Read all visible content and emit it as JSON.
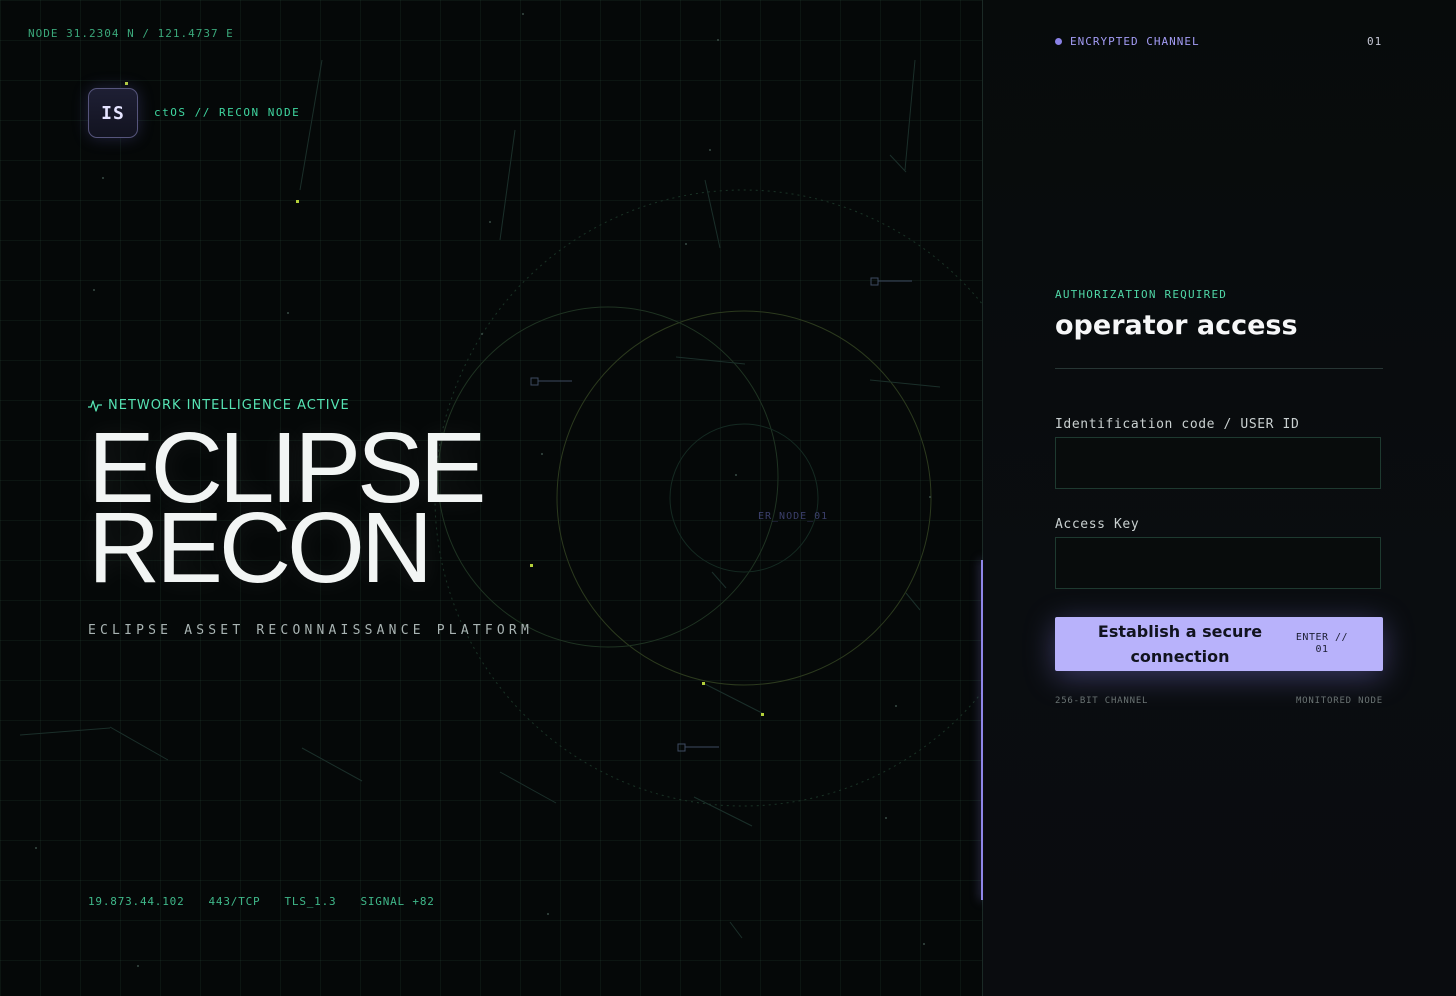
{
  "hero": {
    "coords": "NODE 31.2304 N / 121.4737 E",
    "logo_initials": "IS",
    "logo_label": "ctOS // RECON NODE",
    "status": "NETWORK INTELLIGENCE ACTIVE",
    "title_line1": "ECLIPSE",
    "title_line2": "RECON",
    "subtitle": "ECLIPSE ASSET RECONNAISSANCE PLATFORM",
    "node_label": "ER_NODE_01",
    "stats": [
      "19.873.44.102",
      "443/TCP",
      "TLS_1.3",
      "SIGNAL +82"
    ]
  },
  "panel": {
    "channel_label": "ENCRYPTED CHANNEL",
    "channel_number": "01",
    "auth_required": "AUTHORIZATION REQUIRED",
    "title": "operator access",
    "user_field": {
      "label": "Identification code / USER ID",
      "value": "",
      "placeholder": ""
    },
    "key_field": {
      "label": "Access Key",
      "value": "",
      "placeholder": ""
    },
    "submit": {
      "label": "Establish a secure connection",
      "hint": "ENTER // 01"
    },
    "note_left": "256-BIT CHANNEL",
    "note_right": "MONITORED NODE"
  },
  "colors": {
    "background": "#050808",
    "accent_green": "#3fd6a0",
    "accent_violet": "#b8b2fb",
    "text": "#f2f5f4"
  }
}
